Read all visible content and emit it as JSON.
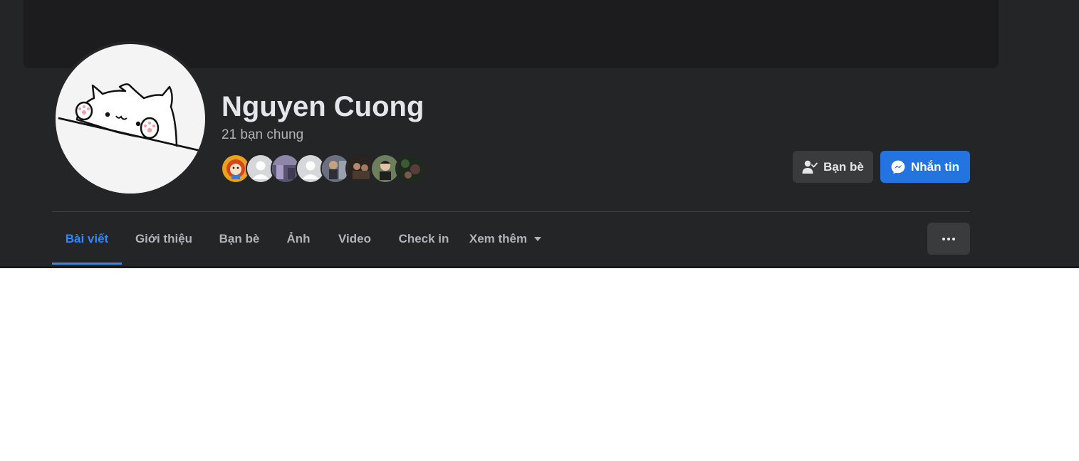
{
  "profile": {
    "name": "Nguyen Cuong",
    "mutual_friends_text": "21 bạn chung"
  },
  "actions": {
    "friends_label": "Bạn bè",
    "message_label": "Nhắn tin"
  },
  "tabs": [
    {
      "label": "Bài viết",
      "active": true
    },
    {
      "label": "Giới thiệu",
      "active": false
    },
    {
      "label": "Bạn bè",
      "active": false
    },
    {
      "label": "Ảnh",
      "active": false
    },
    {
      "label": "Video",
      "active": false
    },
    {
      "label": "Check in",
      "active": false
    },
    {
      "label": "Xem thêm",
      "active": false
    }
  ],
  "colors": {
    "accent": "#2d88ff",
    "message_button": "#2374e1",
    "background": "#242526",
    "text_primary": "#e4e6eb",
    "text_secondary": "#b0b3b8"
  },
  "icons": {
    "friends_button": "person-check-icon",
    "message_button": "messenger-icon",
    "see_more_tab": "caret-down-icon",
    "more_button": "more-dots-icon"
  }
}
